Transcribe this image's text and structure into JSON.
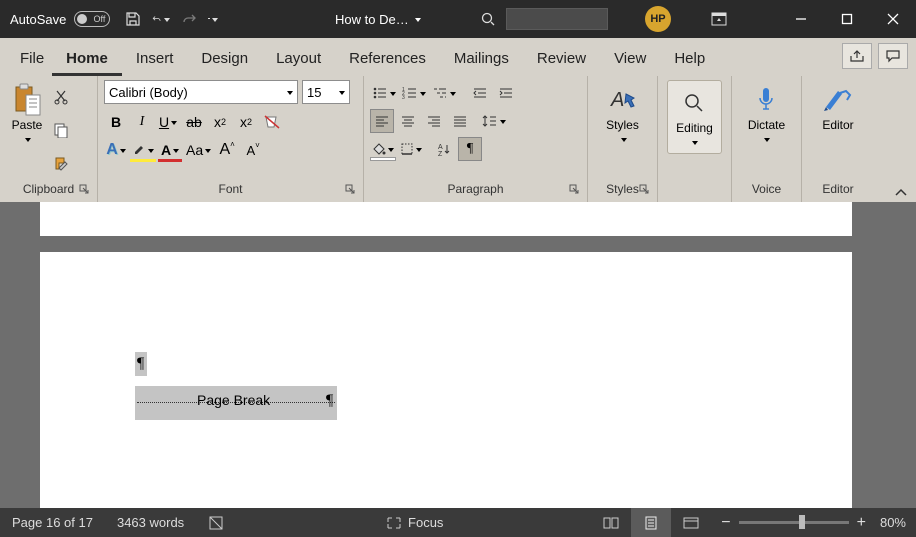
{
  "titlebar": {
    "autosave_label": "AutoSave",
    "autosave_state": "Off",
    "doc_title": "How to De…",
    "user_initials": "HP"
  },
  "tabs": {
    "file": "File",
    "home": "Home",
    "insert": "Insert",
    "design": "Design",
    "layout": "Layout",
    "references": "References",
    "mailings": "Mailings",
    "review": "Review",
    "view": "View",
    "help": "Help"
  },
  "ribbon": {
    "clipboard": {
      "label": "Clipboard",
      "paste": "Paste"
    },
    "font": {
      "label": "Font",
      "name": "Calibri (Body)",
      "size": "15",
      "bold": "B",
      "italic": "I",
      "underline": "U",
      "strike": "ab",
      "subscript": "x",
      "superscript": "x",
      "case": "Aa",
      "grow": "A",
      "shrink": "A",
      "text_effects": "A",
      "highlight": "",
      "font_color": "A",
      "clear": ""
    },
    "paragraph": {
      "label": "Paragraph"
    },
    "styles": {
      "label": "Styles",
      "btn": "Styles"
    },
    "editing": {
      "label": "Editing",
      "btn": "Editing"
    },
    "voice": {
      "label": "Voice",
      "btn": "Dictate"
    },
    "editor": {
      "label": "Editor",
      "btn": "Editor"
    }
  },
  "document": {
    "page_break_text": "Page Break",
    "pilcrow": "¶"
  },
  "statusbar": {
    "page": "Page 16 of 17",
    "words": "3463 words",
    "focus": "Focus",
    "zoom": "80%"
  }
}
